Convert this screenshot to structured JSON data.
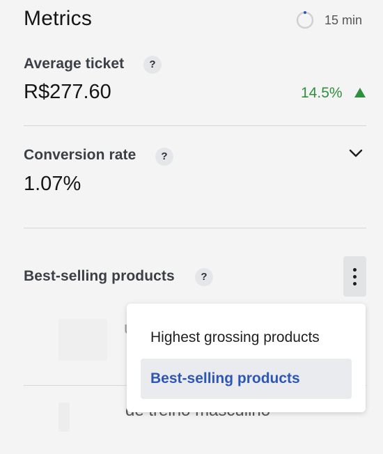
{
  "header": {
    "title": "Metrics",
    "timer_label": "15 min"
  },
  "average_ticket": {
    "label": "Average ticket",
    "help": "?",
    "value": "R$277.60",
    "delta": "14.5%",
    "delta_direction": "up"
  },
  "conversion_rate": {
    "label": "Conversion rate",
    "help": "?",
    "value": "1.07%"
  },
  "best_selling": {
    "label": "Best-selling products",
    "help": "?",
    "list_fragment_1": "u",
    "list_fragment_2": "de treino masculino"
  },
  "dropdown": {
    "items": [
      {
        "label": "Highest grossing products",
        "selected": false
      },
      {
        "label": "Best-selling products",
        "selected": true
      }
    ]
  },
  "colors": {
    "positive": "#2f8f3c",
    "selected_text": "#2e56b5",
    "selected_bg": "#e9ebee"
  }
}
